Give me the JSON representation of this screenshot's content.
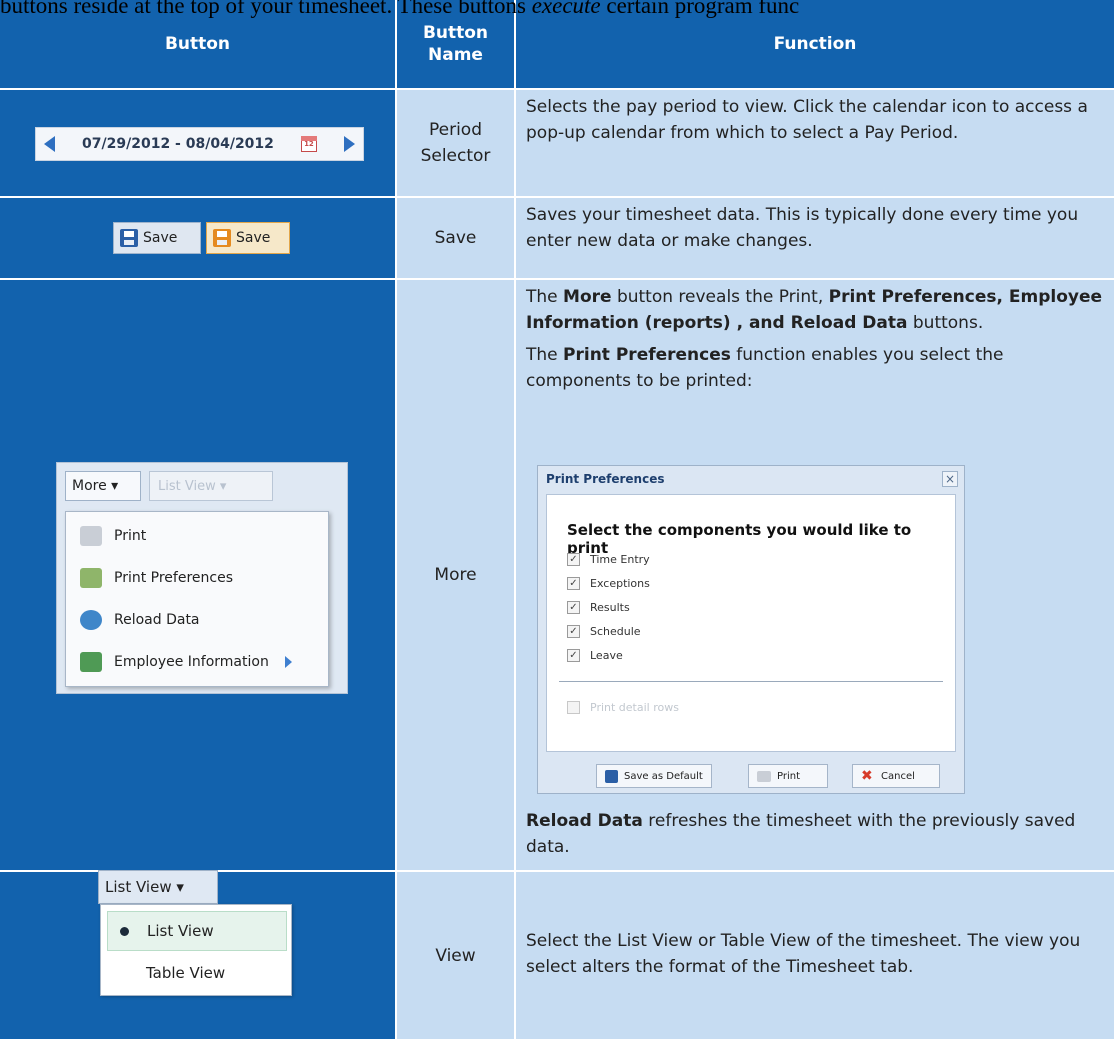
{
  "intro": {
    "lead": "buttons reside at the top of your timesheet. These buttons ",
    "italic": "execute",
    "tail": " certain program func"
  },
  "table": {
    "headers": [
      "Button",
      "Button Name",
      "Function"
    ],
    "rows": [
      {
        "name": "Period Selector",
        "function": [
          "Selects the pay period to view. Click the calendar icon to access a pop-up calendar from which to select a Pay Period."
        ]
      },
      {
        "name": "Save",
        "function": [
          "Saves your timesheet data. This is typically done every time you enter new data or make changes."
        ]
      },
      {
        "name": "More",
        "function_p1": {
          "a": "The ",
          "b1": "More",
          "c": " button reveals the Print, ",
          "b2": "Print Preferences, Employee Information (reports) , and Reload Data",
          "d": " buttons."
        },
        "function_p2": {
          "a": "The ",
          "b1": "Print Preferences",
          "c": " function enables you select the components to be printed:"
        },
        "function_p3": {
          "b1": "Reload Data",
          "c": " refreshes the timesheet with the previously saved data."
        }
      },
      {
        "name": "View",
        "function": [
          "Select the List View or Table View of the timesheet. The view you select alters the format of the Timesheet tab."
        ]
      }
    ]
  },
  "period_widget": {
    "range": "07/29/2012 - 08/04/2012",
    "cal_text": "12"
  },
  "save_widget": {
    "label_a": "Save",
    "label_b": "Save"
  },
  "more_widget": {
    "button": "More ▾",
    "blurred": "List View ▾",
    "items": [
      "Print",
      "Print Preferences",
      "Reload Data",
      "Employee Information"
    ]
  },
  "print_dialog": {
    "title": "Print Preferences",
    "close": "×",
    "heading": "Select the components you would like to print",
    "options": [
      "Time Entry",
      "Exceptions",
      "Results",
      "Schedule",
      "Leave"
    ],
    "disabled_option": "Print detail rows",
    "buttons": [
      "Save as Default",
      "Print",
      "Cancel"
    ]
  },
  "view_widget": {
    "button": "List View ▾",
    "items": [
      "List View",
      "Table View"
    ],
    "selected": "List View"
  },
  "colors": {
    "header_blue": "#1262ad",
    "light_blue": "#c6dcf2",
    "accent": "#2e6fc0"
  }
}
